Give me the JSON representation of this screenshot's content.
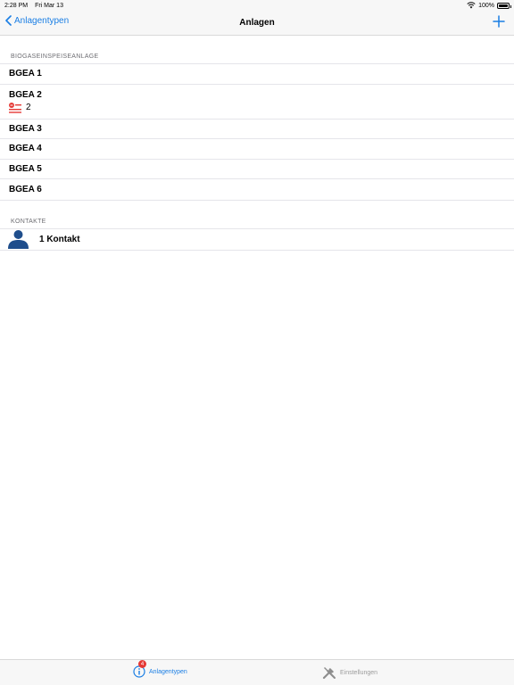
{
  "status_bar": {
    "time": "2:28 PM",
    "date": "Fri Mar 13",
    "battery": "100%",
    "battery_level": 1.0
  },
  "nav": {
    "back_label": "Anlagentypen",
    "title": "Anlagen",
    "add_icon": "plus-icon"
  },
  "sections": {
    "biogas": {
      "header": "BIOGASEINSPEISEANLAGE",
      "items": [
        {
          "label": "BGEA 1"
        },
        {
          "label": "BGEA 2",
          "sub_count": "2",
          "sub_icon": "red-list-icon"
        },
        {
          "label": "BGEA 3"
        },
        {
          "label": "BGEA 4"
        },
        {
          "label": "BGEA 5"
        },
        {
          "label": "BGEA 6"
        }
      ]
    },
    "contacts": {
      "header": "KONTAKTE",
      "label": "1 Kontakt",
      "icon": "person-icon"
    }
  },
  "tab_bar": {
    "tabs": [
      {
        "label": "Anlagentypen",
        "badge": "4",
        "icon": "info-icon",
        "active": true
      },
      {
        "label": "Einstellungen",
        "icon": "tools-icon",
        "active": false
      }
    ]
  },
  "colors": {
    "accent": "#1a7ee4",
    "contact_icon": "#1f4e8c",
    "badge": "#e53935",
    "inactive": "#9b9b9b"
  }
}
